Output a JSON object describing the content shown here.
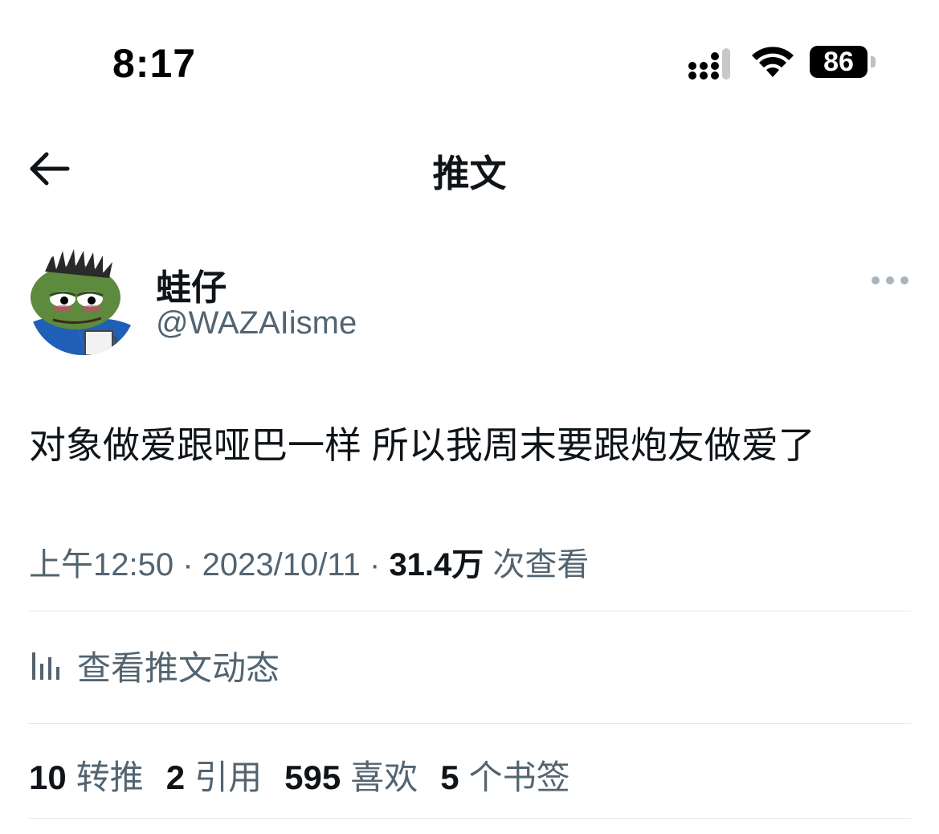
{
  "status_bar": {
    "time": "8:17",
    "battery": "86"
  },
  "nav": {
    "title": "推文",
    "back_icon": "arrow-left-icon"
  },
  "author": {
    "display_name": "蛙仔",
    "handle": "@WAZAIisme",
    "avatar": "pepe-frog-avatar",
    "more_icon": "more-horizontal-icon"
  },
  "tweet": {
    "text": "对象做爱跟哑巴一样 所以我周末要跟炮友做爱了"
  },
  "meta": {
    "time": "上午12:50",
    "separator1": " · ",
    "date": "2023/10/11",
    "separator2": " · ",
    "views_count": "31.4万",
    "views_label": " 次查看"
  },
  "activity": {
    "label": "查看推文动态",
    "icon": "analytics-bar-icon"
  },
  "stats": [
    {
      "num": "10",
      "label": "转推"
    },
    {
      "num": "2",
      "label": "引用"
    },
    {
      "num": "595",
      "label": "喜欢"
    },
    {
      "num": "5",
      "label": "个书签"
    }
  ],
  "colors": {
    "text_primary": "#0f1419",
    "text_secondary": "#536471",
    "divider": "#e6e9eb"
  }
}
